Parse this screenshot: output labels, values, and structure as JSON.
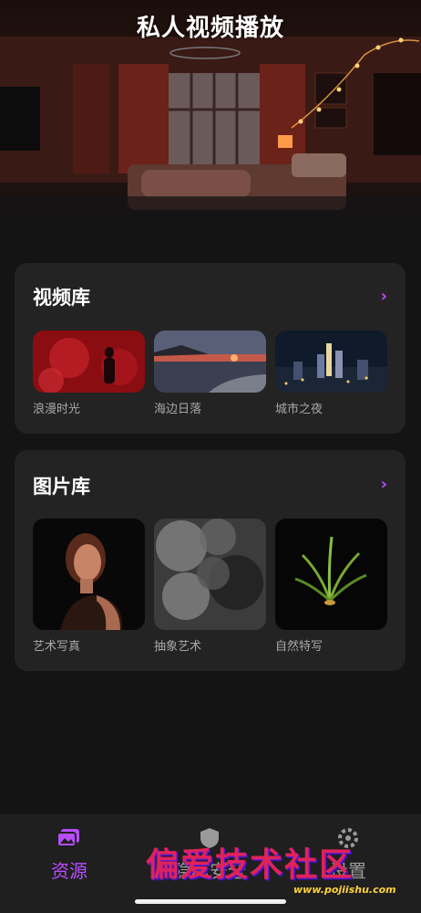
{
  "header": {
    "title": "私人视频播放"
  },
  "video_library": {
    "title": "视频库",
    "more_icon": "chevron-right-icon",
    "items": [
      {
        "label": "浪漫时光"
      },
      {
        "label": "海边日落"
      },
      {
        "label": "城市之夜"
      }
    ]
  },
  "photo_library": {
    "title": "图片库",
    "more_icon": "chevron-right-icon",
    "items": [
      {
        "label": "艺术写真"
      },
      {
        "label": "抽象艺术"
      },
      {
        "label": "自然特写"
      }
    ]
  },
  "tabbar": {
    "tabs": [
      {
        "label": "资源",
        "icon": "photos-icon",
        "active": true
      },
      {
        "label": "隐私安全",
        "icon": "shield-icon",
        "active": false
      },
      {
        "label": "设置",
        "icon": "gear-icon",
        "active": false
      }
    ]
  },
  "watermark": {
    "text": "偏爱技术社区",
    "url": "www.pojiishu.com"
  },
  "colors": {
    "accent": "#b84dff",
    "background": "#141414",
    "card": "#232323"
  }
}
